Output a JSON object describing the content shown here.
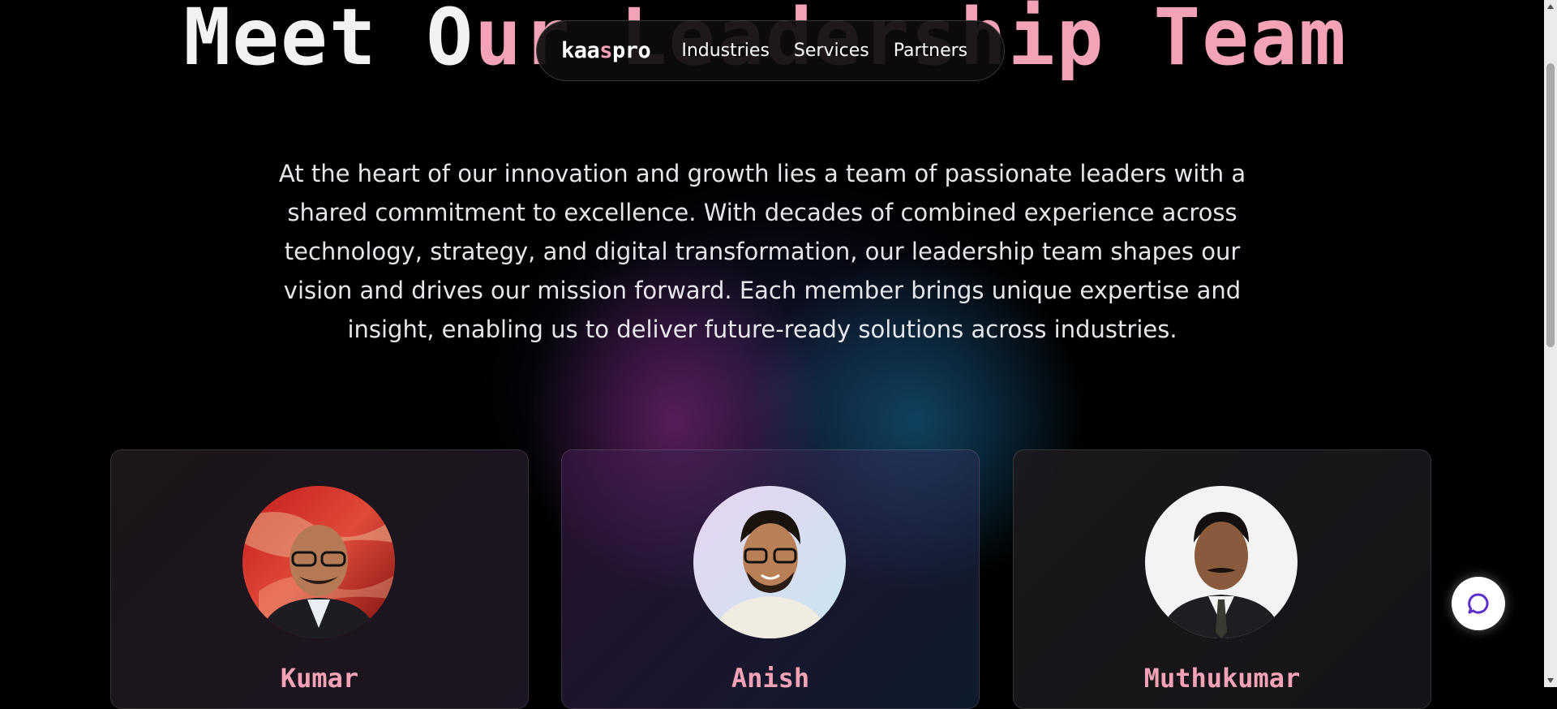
{
  "hero": {
    "title_white": "Meet O",
    "title_pink": "ur Leadership Team"
  },
  "nav": {
    "logo_a": "kaa",
    "logo_accent": "s",
    "logo_b": "pro",
    "links": [
      "Industries",
      "Services",
      "Partners"
    ]
  },
  "intro": {
    "text": "At the heart of our innovation and growth lies a team of passionate leaders with a shared commitment to excellence. With decades of combined experience across technology, strategy, and digital transformation, our leadership team shapes our vision and drives our mission forward. Each member brings unique expertise and insight, enabling us to deliver future-ready solutions across industries."
  },
  "team": [
    {
      "name": "Kumar"
    },
    {
      "name": "Anish"
    },
    {
      "name": "Muthukumar"
    }
  ],
  "chat": {
    "icon": "chat-bubble-icon"
  },
  "colors": {
    "background": "#000000",
    "accent_pink": "#f4a3b6",
    "text": "#e6e6ea",
    "chat_icon": "#5b2fc9"
  }
}
